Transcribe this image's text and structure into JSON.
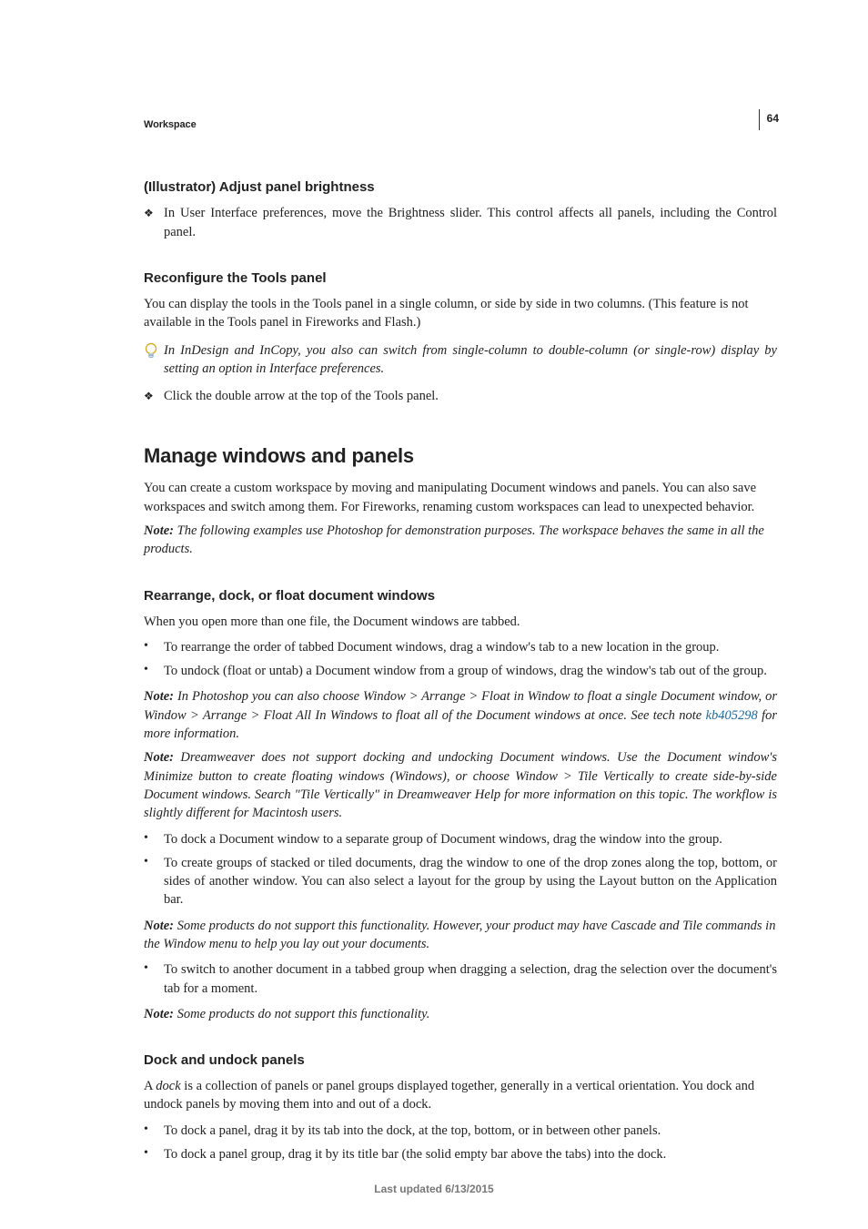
{
  "header": {
    "running": "Workspace",
    "page_number": "64"
  },
  "s1": {
    "title": "(Illustrator) Adjust panel brightness",
    "b1": "In User Interface preferences, move the Brightness slider. This control affects all panels, including the Control panel."
  },
  "s2": {
    "title": "Reconfigure the Tools panel",
    "p1": "You can display the tools in the Tools panel in a single column, or side by side in two columns. (This feature is not available in the Tools panel in Fireworks and Flash.)",
    "tip": "In InDesign and InCopy, you also can switch from single-column to double-column (or single-row) display by setting an option in Interface preferences.",
    "b1": "Click the double arrow at the top of the Tools panel."
  },
  "s3": {
    "title": "Manage windows and panels",
    "p1": "You can create a custom workspace by moving and manipulating Document windows and panels. You can also save workspaces and switch among them. For Fireworks, renaming custom workspaces can lead to unexpected behavior.",
    "note_label": "Note: ",
    "note1": "The following examples use Photoshop for demonstration purposes. The workspace behaves the same in all the products."
  },
  "s4": {
    "title": "Rearrange, dock, or float document windows",
    "p1": "When you open more than one file, the Document windows are tabbed.",
    "li1": "To rearrange the order of tabbed Document windows, drag a window's tab to a new location in the group.",
    "li2": "To undock (float or untab) a Document window from a group of windows, drag the window's tab out of the group.",
    "note2a": "In Photoshop you can also choose Window > Arrange > Float in Window to float a single Document window, or Window > Arrange > Float All In Windows to float all of the Document windows at once. See tech note ",
    "note2_link": "kb405298",
    "note2b": " for more information.",
    "note3": "Dreamweaver does not support docking and undocking Document windows. Use the Document window's Minimize button to create floating windows (Windows), or choose Window > Tile Vertically to create side-by-side Document windows. Search \"Tile Vertically\" in Dreamweaver Help for more information on this topic. The workflow is slightly different for Macintosh users.",
    "li3": "To dock a Document window to a separate group of Document windows, drag the window into the group.",
    "li4": "To create groups of stacked or tiled documents, drag the window to one of the drop zones along the top, bottom, or sides of another window. You can also select a layout for the group by using the Layout button on the Application bar.",
    "note4": "Some products do not support this functionality. However, your product may have Cascade and Tile commands in the Window menu to help you lay out your documents.",
    "li5": "To switch to another document in a tabbed group when dragging a selection, drag the selection over the document's tab for a moment.",
    "note5": " Some products do not support this functionality."
  },
  "s5": {
    "title": "Dock and undock panels",
    "p1a": "A ",
    "p1_term": "dock",
    "p1b": " is a collection of panels or panel groups displayed together, generally in a vertical orientation. You dock and undock panels by moving them into and out of a dock.",
    "li1": "To dock a panel, drag it by its tab into the dock, at the top, bottom, or in between other panels.",
    "li2": "To dock a panel group, drag it by its title bar (the solid empty bar above the tabs) into the dock."
  },
  "footer": {
    "text": "Last updated 6/13/2015"
  },
  "icons": {
    "tip": "tip-icon"
  }
}
